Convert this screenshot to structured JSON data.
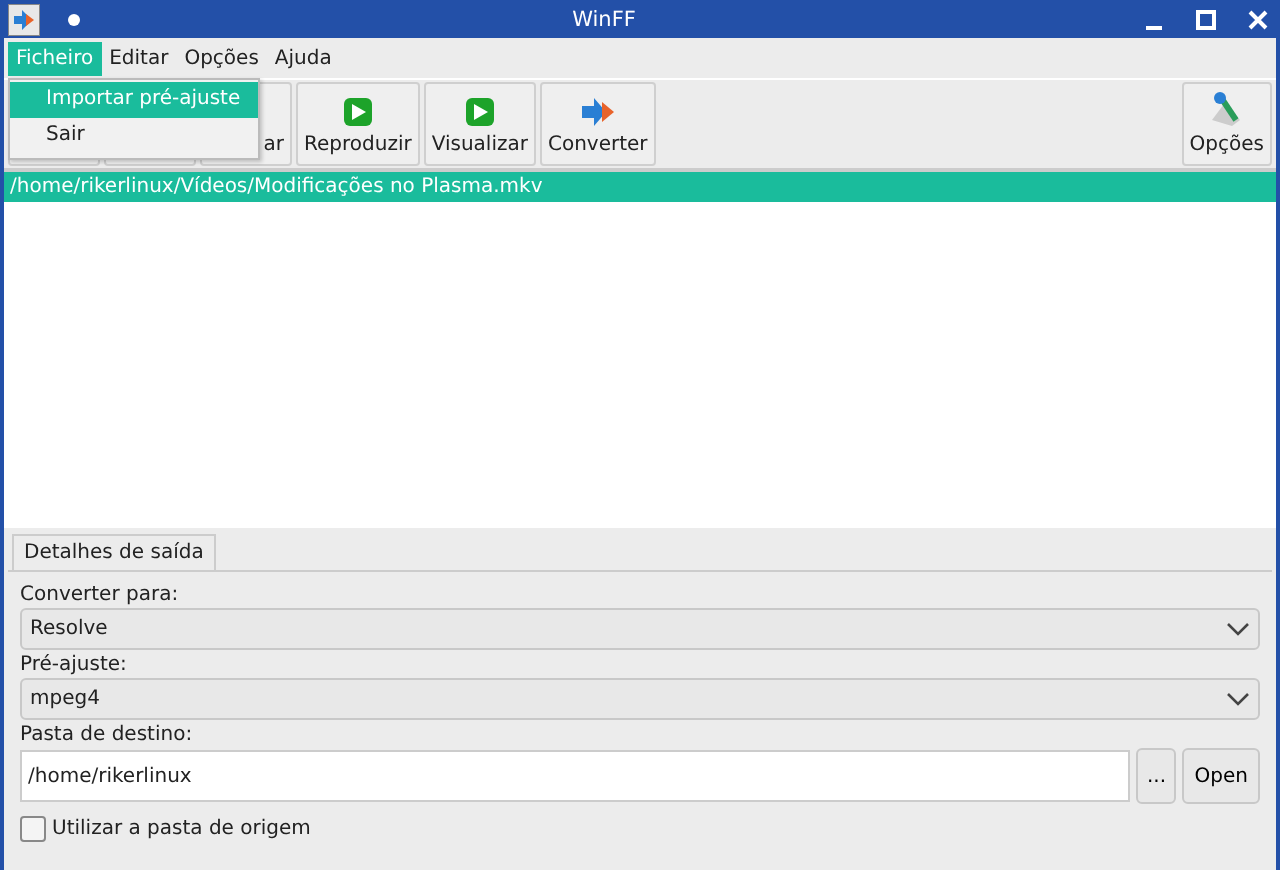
{
  "window": {
    "title": "WinFF"
  },
  "menu": [
    {
      "label": "Ficheiro",
      "selected": true
    },
    {
      "label": "Editar",
      "selected": false
    },
    {
      "label": "Opções",
      "selected": false
    },
    {
      "label": "Ajuda",
      "selected": false
    }
  ],
  "open_menu": {
    "items": [
      {
        "label": "Importar pré-ajuste",
        "selected": true
      },
      {
        "label": "Sair",
        "selected": false
      }
    ]
  },
  "toolbar": [
    {
      "kind": "hidden"
    },
    {
      "kind": "hidden"
    },
    {
      "kind": "hidden",
      "label": "ar"
    },
    {
      "kind": "play",
      "label": "Reproduzir"
    },
    {
      "kind": "play",
      "label": "Visualizar"
    },
    {
      "kind": "convert",
      "label": "Converter"
    }
  ],
  "toolbar_right": {
    "label": "Opções"
  },
  "files": [
    {
      "path": "/home/rikerlinux/Vídeos/Modificações no Plasma.mkv",
      "selected": true
    }
  ],
  "tabs": [
    {
      "label": "Detalhes de saída",
      "selected": true
    }
  ],
  "convert_to": {
    "label": "Converter para:",
    "value": "Resolve"
  },
  "preset": {
    "label": "Pré-ajuste:",
    "value": "mpeg4"
  },
  "destination": {
    "label": "Pasta de destino:",
    "value": "/home/rikerlinux",
    "browse": "...",
    "open": "Open"
  },
  "use_source_folder": {
    "label": "Utilizar a pasta de origem",
    "checked": false
  }
}
